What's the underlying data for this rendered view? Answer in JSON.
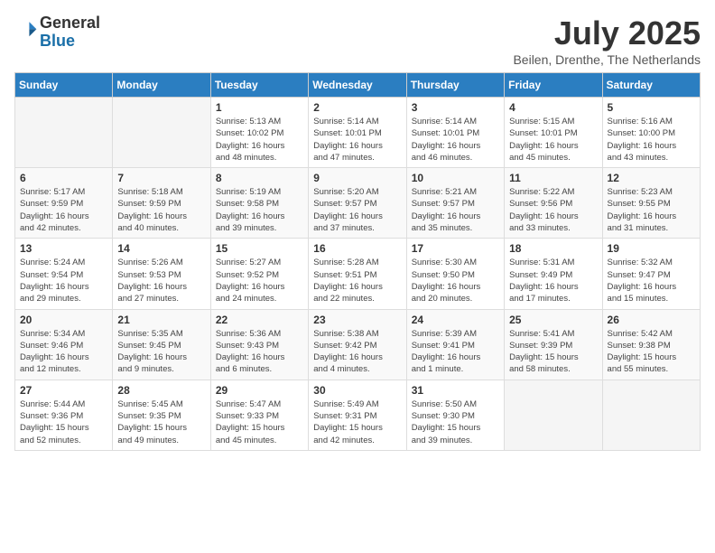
{
  "header": {
    "logo_general": "General",
    "logo_blue": "Blue",
    "month_title": "July 2025",
    "subtitle": "Beilen, Drenthe, The Netherlands"
  },
  "weekdays": [
    "Sunday",
    "Monday",
    "Tuesday",
    "Wednesday",
    "Thursday",
    "Friday",
    "Saturday"
  ],
  "weeks": [
    [
      {
        "day": "",
        "info": ""
      },
      {
        "day": "",
        "info": ""
      },
      {
        "day": "1",
        "info": "Sunrise: 5:13 AM\nSunset: 10:02 PM\nDaylight: 16 hours\nand 48 minutes."
      },
      {
        "day": "2",
        "info": "Sunrise: 5:14 AM\nSunset: 10:01 PM\nDaylight: 16 hours\nand 47 minutes."
      },
      {
        "day": "3",
        "info": "Sunrise: 5:14 AM\nSunset: 10:01 PM\nDaylight: 16 hours\nand 46 minutes."
      },
      {
        "day": "4",
        "info": "Sunrise: 5:15 AM\nSunset: 10:01 PM\nDaylight: 16 hours\nand 45 minutes."
      },
      {
        "day": "5",
        "info": "Sunrise: 5:16 AM\nSunset: 10:00 PM\nDaylight: 16 hours\nand 43 minutes."
      }
    ],
    [
      {
        "day": "6",
        "info": "Sunrise: 5:17 AM\nSunset: 9:59 PM\nDaylight: 16 hours\nand 42 minutes."
      },
      {
        "day": "7",
        "info": "Sunrise: 5:18 AM\nSunset: 9:59 PM\nDaylight: 16 hours\nand 40 minutes."
      },
      {
        "day": "8",
        "info": "Sunrise: 5:19 AM\nSunset: 9:58 PM\nDaylight: 16 hours\nand 39 minutes."
      },
      {
        "day": "9",
        "info": "Sunrise: 5:20 AM\nSunset: 9:57 PM\nDaylight: 16 hours\nand 37 minutes."
      },
      {
        "day": "10",
        "info": "Sunrise: 5:21 AM\nSunset: 9:57 PM\nDaylight: 16 hours\nand 35 minutes."
      },
      {
        "day": "11",
        "info": "Sunrise: 5:22 AM\nSunset: 9:56 PM\nDaylight: 16 hours\nand 33 minutes."
      },
      {
        "day": "12",
        "info": "Sunrise: 5:23 AM\nSunset: 9:55 PM\nDaylight: 16 hours\nand 31 minutes."
      }
    ],
    [
      {
        "day": "13",
        "info": "Sunrise: 5:24 AM\nSunset: 9:54 PM\nDaylight: 16 hours\nand 29 minutes."
      },
      {
        "day": "14",
        "info": "Sunrise: 5:26 AM\nSunset: 9:53 PM\nDaylight: 16 hours\nand 27 minutes."
      },
      {
        "day": "15",
        "info": "Sunrise: 5:27 AM\nSunset: 9:52 PM\nDaylight: 16 hours\nand 24 minutes."
      },
      {
        "day": "16",
        "info": "Sunrise: 5:28 AM\nSunset: 9:51 PM\nDaylight: 16 hours\nand 22 minutes."
      },
      {
        "day": "17",
        "info": "Sunrise: 5:30 AM\nSunset: 9:50 PM\nDaylight: 16 hours\nand 20 minutes."
      },
      {
        "day": "18",
        "info": "Sunrise: 5:31 AM\nSunset: 9:49 PM\nDaylight: 16 hours\nand 17 minutes."
      },
      {
        "day": "19",
        "info": "Sunrise: 5:32 AM\nSunset: 9:47 PM\nDaylight: 16 hours\nand 15 minutes."
      }
    ],
    [
      {
        "day": "20",
        "info": "Sunrise: 5:34 AM\nSunset: 9:46 PM\nDaylight: 16 hours\nand 12 minutes."
      },
      {
        "day": "21",
        "info": "Sunrise: 5:35 AM\nSunset: 9:45 PM\nDaylight: 16 hours\nand 9 minutes."
      },
      {
        "day": "22",
        "info": "Sunrise: 5:36 AM\nSunset: 9:43 PM\nDaylight: 16 hours\nand 6 minutes."
      },
      {
        "day": "23",
        "info": "Sunrise: 5:38 AM\nSunset: 9:42 PM\nDaylight: 16 hours\nand 4 minutes."
      },
      {
        "day": "24",
        "info": "Sunrise: 5:39 AM\nSunset: 9:41 PM\nDaylight: 16 hours\nand 1 minute."
      },
      {
        "day": "25",
        "info": "Sunrise: 5:41 AM\nSunset: 9:39 PM\nDaylight: 15 hours\nand 58 minutes."
      },
      {
        "day": "26",
        "info": "Sunrise: 5:42 AM\nSunset: 9:38 PM\nDaylight: 15 hours\nand 55 minutes."
      }
    ],
    [
      {
        "day": "27",
        "info": "Sunrise: 5:44 AM\nSunset: 9:36 PM\nDaylight: 15 hours\nand 52 minutes."
      },
      {
        "day": "28",
        "info": "Sunrise: 5:45 AM\nSunset: 9:35 PM\nDaylight: 15 hours\nand 49 minutes."
      },
      {
        "day": "29",
        "info": "Sunrise: 5:47 AM\nSunset: 9:33 PM\nDaylight: 15 hours\nand 45 minutes."
      },
      {
        "day": "30",
        "info": "Sunrise: 5:49 AM\nSunset: 9:31 PM\nDaylight: 15 hours\nand 42 minutes."
      },
      {
        "day": "31",
        "info": "Sunrise: 5:50 AM\nSunset: 9:30 PM\nDaylight: 15 hours\nand 39 minutes."
      },
      {
        "day": "",
        "info": ""
      },
      {
        "day": "",
        "info": ""
      }
    ]
  ]
}
